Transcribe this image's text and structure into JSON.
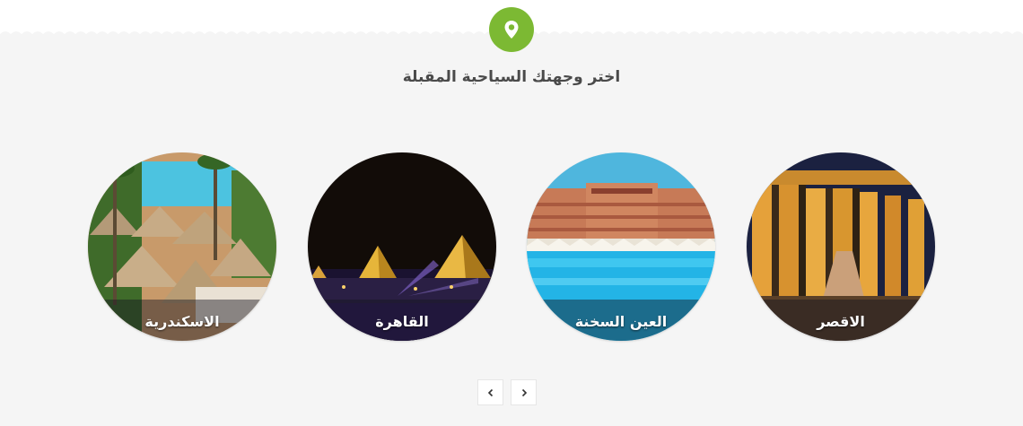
{
  "section": {
    "title": "اختر وجهتك السياحية المقبلة",
    "icon": "map-pin-icon",
    "accent_color": "#7cb933",
    "background_color": "#f5f5f5"
  },
  "destinations": [
    {
      "name": "الاسكندرية",
      "image": "alexandria-resort-image"
    },
    {
      "name": "القاهرة",
      "image": "cairo-pyramids-image"
    },
    {
      "name": "العين السخنة",
      "image": "ain-sokhna-hotel-image"
    },
    {
      "name": "الاقصر",
      "image": "luxor-temple-image"
    }
  ],
  "carousel": {
    "prev_icon": "chevron-left-icon",
    "next_icon": "chevron-right-icon"
  }
}
